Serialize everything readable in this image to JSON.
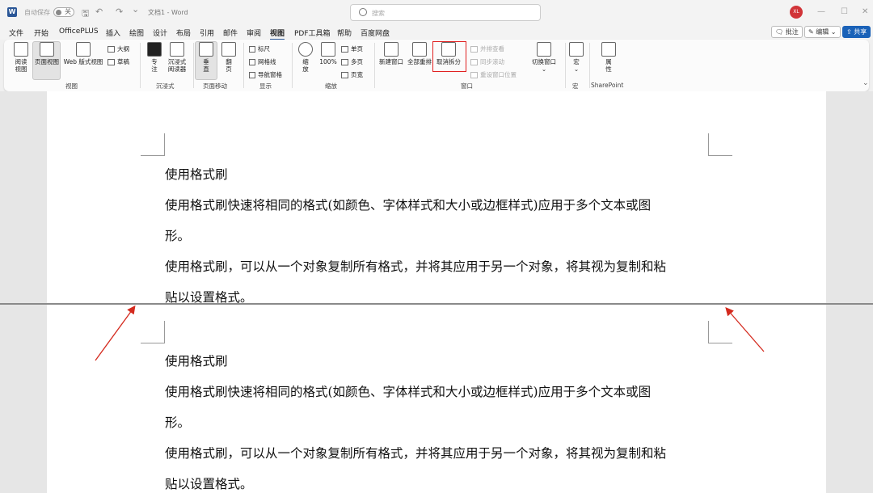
{
  "titlebar": {
    "app_letter": "W",
    "autosave_label": "自动保存",
    "autosave_state": "关",
    "doc_title": "文档1 - Word",
    "search_placeholder": "搜索",
    "user_initials": "XL",
    "qa_save": "🖫",
    "qa_undo": "↶",
    "qa_redo": "↷",
    "qa_more": "⌄",
    "win_min": "—",
    "win_max": "☐",
    "win_close": "✕"
  },
  "menu": {
    "items": [
      "文件",
      "开始",
      "OfficePLUS",
      "插入",
      "绘图",
      "设计",
      "布局",
      "引用",
      "邮件",
      "审阅",
      "视图",
      "PDF工具箱",
      "帮助",
      "百度网盘"
    ],
    "active_index": 10,
    "comment_label": "批注",
    "edit_label": "编辑",
    "share_label": "共享"
  },
  "ribbon": {
    "groups": {
      "view": "视图",
      "immersive": "沉浸式",
      "page_move": "页面移动",
      "show": "显示",
      "zoom": "缩放",
      "window": "窗口",
      "macro": "宏",
      "sharepoint": "SharePoint"
    },
    "view_buttons": {
      "read_line1": "阅读",
      "read_line2": "视图",
      "page_view": "页面视图",
      "web_view": "Web 版式视图",
      "outline": "大纲",
      "draft": "草稿"
    },
    "immersive_buttons": {
      "focus_line1": "专",
      "focus_line2": "注",
      "reader_line1": "沉浸式",
      "reader_line2": "阅读器"
    },
    "page_move_buttons": {
      "vertical_line1": "垂",
      "vertical_line2": "直",
      "flip_line1": "翻",
      "flip_line2": "页"
    },
    "show_checks": [
      "标尺",
      "网格线",
      "导航窗格"
    ],
    "zoom_buttons": {
      "zoom_line1": "缩",
      "zoom_line2": "放",
      "hundred": "100%",
      "one_page": "单页",
      "multi_page": "多页",
      "page_width": "页宽"
    },
    "window_buttons": {
      "new_window": "新建窗口",
      "arrange_all": "全部重排",
      "unsplit": "取消拆分",
      "side_by_side": "并排查看",
      "sync_scroll": "同步滚动",
      "reset_position": "重设窗口位置",
      "switch_window": "切换窗口"
    },
    "macro_label": "宏",
    "properties_line1": "属",
    "properties_line2": "性"
  },
  "document": {
    "heading": "使用格式刷",
    "para1_line1": "使用格式刷快速将相同的格式(如颜色、字体样式和大小或边框样式)应用于多个文本或图",
    "para1_line2": "形。",
    "para2_line1": "使用格式刷，可以从一个对象复制所有格式，并将其应用于另一个对象，将其视为复制和粘",
    "para2_line2": "贴以设置格式。"
  },
  "colors": {
    "accent": "#2b5797",
    "share_button": "#1a62b8",
    "highlight_box": "#e02020",
    "annotation_arrow": "#d42a1e",
    "avatar": "#d13438"
  }
}
